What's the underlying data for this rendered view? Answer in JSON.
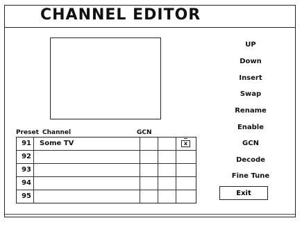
{
  "window": {
    "title": "CHANNEL EDITOR"
  },
  "table": {
    "headers": {
      "preset": "Preset",
      "channel": "Channel",
      "gcn": "GCN"
    },
    "rows": [
      {
        "number": "91",
        "name": "Some TV",
        "icon": "tv-icon",
        "icon_glyph": "x"
      },
      {
        "number": "92",
        "name": ""
      },
      {
        "number": "93",
        "name": ""
      },
      {
        "number": "94",
        "name": ""
      },
      {
        "number": "95",
        "name": ""
      }
    ]
  },
  "menu": {
    "items": [
      "UP",
      "Down",
      "Insert",
      "Swap",
      "Rename",
      "Enable",
      "GCN",
      "Decode",
      "Fine Tune"
    ],
    "exit_label": "Exit"
  }
}
